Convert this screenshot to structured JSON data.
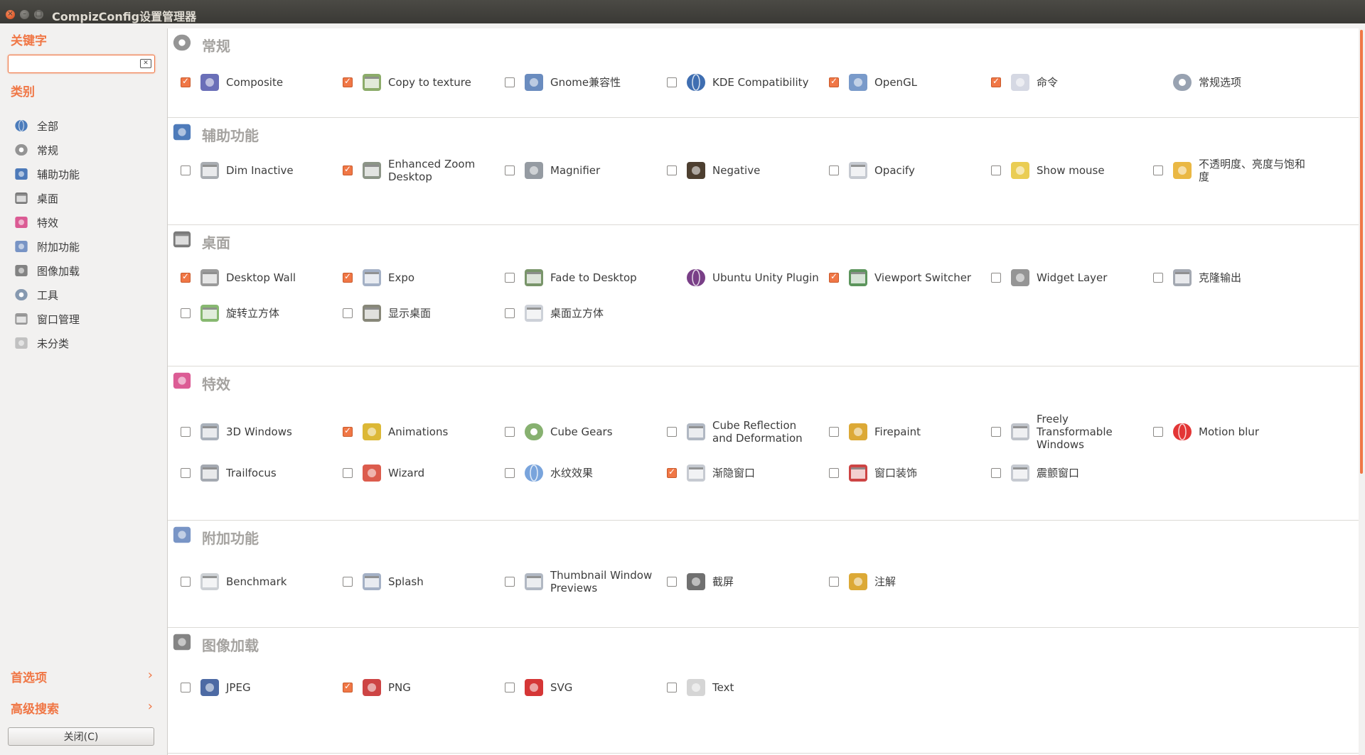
{
  "window": {
    "title": "CompizConfig设置管理器"
  },
  "sidebar": {
    "keyword_heading": "关键字",
    "search": {
      "value": "",
      "placeholder": ""
    },
    "category_heading": "类别",
    "categories": [
      {
        "label": "全部",
        "icon": "globe-icon",
        "color": "#3a6fb5"
      },
      {
        "label": "常规",
        "icon": "gear-icon",
        "color": "#8a8a8a"
      },
      {
        "label": "辅助功能",
        "icon": "accessibility-icon",
        "color": "#3b6db3"
      },
      {
        "label": "桌面",
        "icon": "desktop-icon",
        "color": "#6b6b6b"
      },
      {
        "label": "特效",
        "icon": "fireworks-icon",
        "color": "#d84a8a"
      },
      {
        "label": "附加功能",
        "icon": "gift-icon",
        "color": "#6a8ac0"
      },
      {
        "label": "图像加载",
        "icon": "image-loading-icon",
        "color": "#777777"
      },
      {
        "label": "工具",
        "icon": "tools-icon",
        "color": "#7a8fa8"
      },
      {
        "label": "窗口管理",
        "icon": "window-management-icon",
        "color": "#8d8d8d"
      },
      {
        "label": "未分类",
        "icon": "uncategorized-icon",
        "color": "#bbbbbb"
      }
    ],
    "preferences_label": "首选项",
    "advanced_search_label": "高级搜索",
    "close_button_label": "关闭(C)"
  },
  "sections": [
    {
      "id": "general",
      "title": "常规",
      "icon": "gear-icon",
      "color": "#8a8a8a",
      "plugins": [
        {
          "label": "Composite",
          "checked": true,
          "icon": "composite-icon",
          "color": "#5a5fb0"
        },
        {
          "label": "Copy to texture",
          "checked": true,
          "icon": "copy-to-texture-icon",
          "color": "#7fa35a"
        },
        {
          "label": "Gnome兼容性",
          "checked": false,
          "icon": "gnome-foot-icon",
          "color": "#5a7fb8"
        },
        {
          "label": "KDE Compatibility",
          "checked": false,
          "icon": "kde-icon",
          "color": "#2a5ea8"
        },
        {
          "label": "OpenGL",
          "checked": true,
          "icon": "opengl-icon",
          "color": "#6a8fc4"
        },
        {
          "label": "命令",
          "checked": true,
          "icon": "keyboard-command-icon",
          "color": "#d0d4e0"
        },
        {
          "label": "常规选项",
          "checked": null,
          "icon": "tools-icon",
          "color": "#8d98a8"
        }
      ]
    },
    {
      "id": "accessibility",
      "title": "辅助功能",
      "icon": "accessibility-icon",
      "color": "#3b6db3",
      "plugins": [
        {
          "label": "Dim Inactive",
          "checked": false,
          "icon": "dim-inactive-icon",
          "color": "#a0a4aa"
        },
        {
          "label": "Enhanced Zoom Desktop",
          "checked": true,
          "icon": "zoom-desktop-icon",
          "color": "#7f8a7a"
        },
        {
          "label": "Magnifier",
          "checked": false,
          "icon": "magnifier-icon",
          "color": "#8a9098"
        },
        {
          "label": "Negative",
          "checked": false,
          "icon": "negative-icon",
          "color": "#3a2a1a"
        },
        {
          "label": "Opacify",
          "checked": false,
          "icon": "opacify-icon",
          "color": "#c0c4cc"
        },
        {
          "label": "Show mouse",
          "checked": false,
          "icon": "show-mouse-icon",
          "color": "#e8c840"
        },
        {
          "label": "不透明度、亮度与饱和度",
          "checked": false,
          "icon": "brightness-icon",
          "color": "#e8b030"
        }
      ]
    },
    {
      "id": "desktop",
      "title": "桌面",
      "icon": "desktop-icon",
      "color": "#6b6b6b",
      "plugins": [
        {
          "label": "Desktop Wall",
          "checked": true,
          "icon": "desktop-wall-icon",
          "color": "#909090"
        },
        {
          "label": "Expo",
          "checked": true,
          "icon": "expo-icon",
          "color": "#9aa8c0"
        },
        {
          "label": "Fade to Desktop",
          "checked": false,
          "icon": "fade-to-desktop-icon",
          "color": "#6a8a5a"
        },
        {
          "label": "Ubuntu Unity Plugin",
          "checked": null,
          "icon": "ubuntu-unity-icon",
          "color": "#6a2a7a"
        },
        {
          "label": "Viewport Switcher",
          "checked": true,
          "icon": "viewport-switcher-icon",
          "color": "#4a8a4a"
        },
        {
          "label": "Widget Layer",
          "checked": false,
          "icon": "widget-layer-icon",
          "color": "#8a8a8a"
        },
        {
          "label": "克隆输出",
          "checked": false,
          "icon": "clone-output-icon",
          "color": "#9aa0aa"
        },
        {
          "label": "旋转立方体",
          "checked": false,
          "icon": "rotate-cube-icon",
          "color": "#7ab060"
        },
        {
          "label": "显示桌面",
          "checked": false,
          "icon": "show-desktop-icon",
          "color": "#7a7a6a"
        },
        {
          "label": "桌面立方体",
          "checked": false,
          "icon": "desktop-cube-icon",
          "color": "#c8ccd4"
        }
      ]
    },
    {
      "id": "effects",
      "title": "特效",
      "icon": "fireworks-icon",
      "color": "#d84a8a",
      "plugins": [
        {
          "label": "3D Windows",
          "checked": false,
          "icon": "3d-windows-icon",
          "color": "#a0a8b4"
        },
        {
          "label": "Animations",
          "checked": true,
          "icon": "magic-lamp-icon",
          "color": "#d8b020"
        },
        {
          "label": "Cube Gears",
          "checked": false,
          "icon": "cube-gears-icon",
          "color": "#7aa860"
        },
        {
          "label": "Cube Reflection and Deformation",
          "checked": false,
          "icon": "cube-reflection-icon",
          "color": "#a8b0bc"
        },
        {
          "label": "Firepaint",
          "checked": false,
          "icon": "firepaint-icon",
          "color": "#d8a020"
        },
        {
          "label": "Freely Transformable Windows",
          "checked": false,
          "icon": "transform-windows-icon",
          "color": "#b8bcc4"
        },
        {
          "label": "Motion blur",
          "checked": false,
          "icon": "motion-blur-icon",
          "color": "#e02020"
        },
        {
          "label": "Trailfocus",
          "checked": false,
          "icon": "trailfocus-icon",
          "color": "#9aa0a8"
        },
        {
          "label": "Wizard",
          "checked": false,
          "icon": "wizard-stars-icon",
          "color": "#d84a3a"
        },
        {
          "label": "水纹效果",
          "checked": false,
          "icon": "water-drop-icon",
          "color": "#6a9ad8"
        },
        {
          "label": "渐隐窗口",
          "checked": true,
          "icon": "fade-windows-icon",
          "color": "#c0c4cc"
        },
        {
          "label": "窗口装饰",
          "checked": false,
          "icon": "window-decoration-icon",
          "color": "#c83030"
        },
        {
          "label": "震颤窗口",
          "checked": false,
          "icon": "wobbly-windows-icon",
          "color": "#c0c4cc"
        }
      ]
    },
    {
      "id": "extras",
      "title": "附加功能",
      "icon": "gift-icon",
      "color": "#6a8ac0",
      "plugins": [
        {
          "label": "Benchmark",
          "checked": false,
          "icon": "benchmark-icon",
          "color": "#c8ccd0"
        },
        {
          "label": "Splash",
          "checked": false,
          "icon": "splash-icon",
          "color": "#9aa8c0"
        },
        {
          "label": "Thumbnail Window Previews",
          "checked": false,
          "icon": "thumbnail-icon",
          "color": "#a8b0bc"
        },
        {
          "label": "截屏",
          "checked": false,
          "icon": "camera-icon",
          "color": "#606060"
        },
        {
          "label": "注解",
          "checked": false,
          "icon": "annotate-icon",
          "color": "#d8a020"
        }
      ]
    },
    {
      "id": "image-loading",
      "title": "图像加载",
      "icon": "image-loading-icon",
      "color": "#777777",
      "plugins": [
        {
          "label": "JPEG",
          "checked": false,
          "icon": "jpeg-icon",
          "color": "#3a5a9a"
        },
        {
          "label": "PNG",
          "checked": true,
          "icon": "png-icon",
          "color": "#c83030"
        },
        {
          "label": "SVG",
          "checked": false,
          "icon": "svg-icon",
          "color": "#d02020"
        },
        {
          "label": "Text",
          "checked": false,
          "icon": "text-bubble-icon",
          "color": "#d0d0d0"
        }
      ]
    }
  ]
}
